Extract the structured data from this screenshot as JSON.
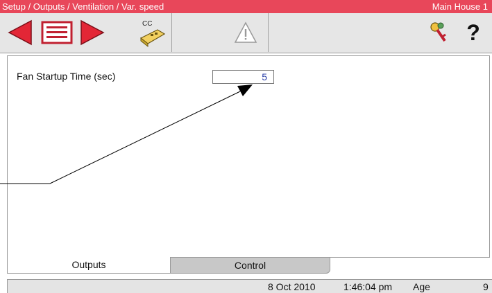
{
  "titlebar": {
    "path": "Setup / Outputs / Ventilation / Var. speed",
    "house": "Main House 1"
  },
  "toolbar": {
    "cc_label": "CC",
    "help_label": "?",
    "icons": [
      "back-arrow-icon",
      "list-icon",
      "forward-arrow-icon",
      "cc-calculator-icon",
      "warning-icon",
      "keys-icon",
      "help-icon"
    ]
  },
  "settings": {
    "fan_startup_label": "Fan Startup Time (sec)",
    "fan_startup_value": "5"
  },
  "tabs": [
    {
      "label": "Outputs",
      "active": true
    },
    {
      "label": "Control",
      "active": false
    }
  ],
  "status": {
    "date": "8 Oct 2010",
    "time": "1:46:04 pm",
    "age_label": "Age",
    "age_value": "9"
  },
  "colors": {
    "title_bar": "#e8475a",
    "arrow_red": "#e32636",
    "toolbar_bg": "#e6e6e6",
    "value_text": "#2a3fa8"
  }
}
